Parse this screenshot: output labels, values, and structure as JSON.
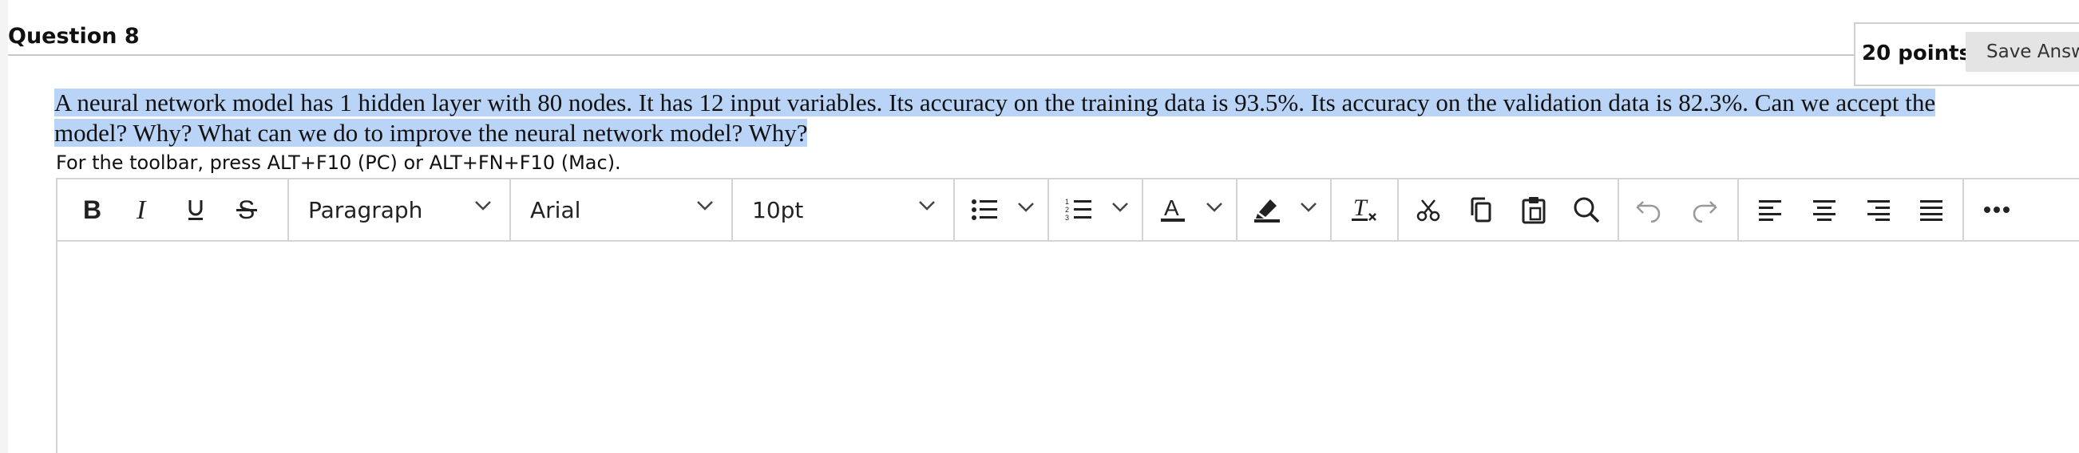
{
  "question": {
    "title": "Question 8",
    "points": "20 points",
    "save_label": "Save Answer",
    "text_line1": "A neural network model has 1 hidden layer with 80 nodes. It has 12 input variables. Its accuracy on the training data is 93.5%. Its accuracy on the validation data is 82.3%. Can we accept the",
    "text_line2": "model? Why? What can we do to improve the neural network model? Why?"
  },
  "editor": {
    "toolbar_hint": "For the toolbar, press ALT+F10 (PC) or ALT+FN+F10 (Mac).",
    "block_format": "Paragraph",
    "font_family": "Arial",
    "font_size": "10pt",
    "body_text": ""
  },
  "icons": {
    "bold": "bold-icon",
    "italic": "italic-icon",
    "underline": "underline-icon",
    "strike": "strikethrough-icon",
    "bullets": "bullet-list-icon",
    "numbers": "numbered-list-icon",
    "text_color": "text-color-icon",
    "highlight": "highlight-icon",
    "clear": "clear-formatting-icon",
    "cut": "cut-icon",
    "copy": "copy-icon",
    "paste": "paste-icon",
    "find": "search-icon",
    "undo": "undo-icon",
    "redo": "redo-icon",
    "align_left": "align-left-icon",
    "align_center": "align-center-icon",
    "align_right": "align-right-icon",
    "justify": "justify-icon",
    "more": "more-icon"
  },
  "colors": {
    "selection_highlight": "#b9d4f6",
    "border": "#d4d4d4",
    "save_button_bg": "#e4e4e4"
  }
}
